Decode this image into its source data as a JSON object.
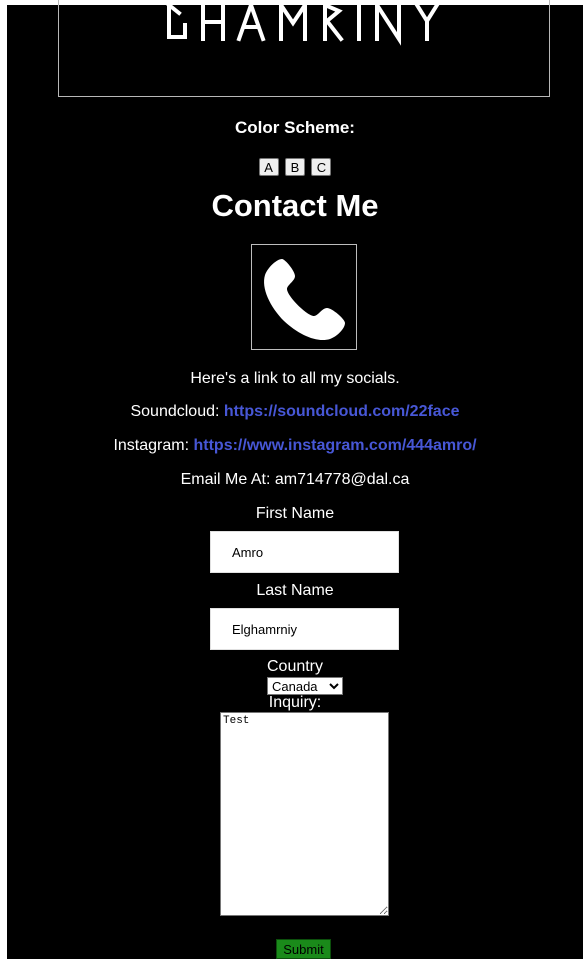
{
  "banner": {
    "logo_text": "GHAMRINY"
  },
  "color_scheme": {
    "label": "Color Scheme:",
    "buttons": [
      "A",
      "B",
      "C"
    ]
  },
  "contact": {
    "title": "Contact Me",
    "icon": "phone-icon",
    "socials_intro": "Here's a link to all my socials.",
    "soundcloud_label": "Soundcloud:",
    "soundcloud_url": "https://soundcloud.com/22face",
    "instagram_label": "Instagram:",
    "instagram_url": "https://www.instagram.com/444amro/",
    "email_line": "Email Me At: am714778@dal.ca"
  },
  "form": {
    "first_name_label": "First Name",
    "first_name_value": "Amro",
    "last_name_label": "Last Name",
    "last_name_value": "Elghamrniy",
    "country_label": "Country",
    "country_selected": "Canada",
    "inquiry_label": "Inquiry:",
    "inquiry_value": "Test",
    "submit_label": "Submit"
  },
  "colors": {
    "background": "#000000",
    "text": "#ffffff",
    "link": "#4757d6",
    "submit": "#1a8a1a"
  }
}
